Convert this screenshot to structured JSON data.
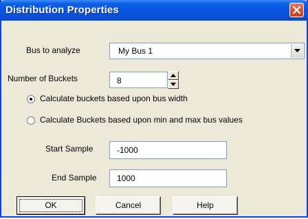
{
  "window": {
    "title": "Distribution Properties"
  },
  "bus": {
    "label": "Bus to analyze",
    "selected": "My Bus 1"
  },
  "buckets": {
    "label": "Number of Buckets",
    "value": "8"
  },
  "radios": [
    {
      "label": "Calculate buckets based upon bus width",
      "checked": true
    },
    {
      "label": "Calculate Buckets based upon min and max bus values",
      "checked": false
    }
  ],
  "start_sample": {
    "label": "Start Sample",
    "value": "-1000"
  },
  "end_sample": {
    "label": "End Sample",
    "value": "1000"
  },
  "buttons": {
    "ok": "OK",
    "cancel": "Cancel",
    "help": "Help"
  },
  "icons": {
    "close": "close-icon",
    "dropdown": "chevron-down-icon",
    "spin_up": "arrow-up-icon",
    "spin_down": "arrow-down-icon"
  },
  "colors": {
    "titlebar": "#0753e0",
    "dialog_bg": "#ece9d8",
    "close_button": "#d9552f",
    "field_border": "#7f9db9"
  }
}
